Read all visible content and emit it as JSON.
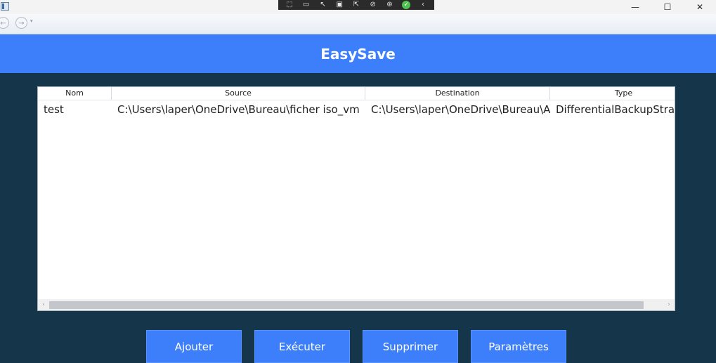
{
  "window": {
    "controls": {
      "minimize": "—",
      "maximize": "☐",
      "close": "✕"
    }
  },
  "debug_toolbar": {
    "icons": [
      "select-element-icon",
      "live-visual-tree-icon",
      "pointer-icon",
      "layout-adorner-icon",
      "track-focus-icon",
      "hot-reload-icon",
      "accessibility-icon",
      "binding-check-icon",
      "collapse-chevron-icon"
    ]
  },
  "navigation": {
    "back": "←",
    "forward": "→",
    "dropdown": "▾"
  },
  "header": {
    "title": "EasySave",
    "color": "#3d7ffa"
  },
  "grid": {
    "columns": [
      "Nom",
      "Source",
      "Destination",
      "Type"
    ],
    "rows": [
      {
        "nom": "test",
        "source": "C:\\Users\\laper\\OneDrive\\Bureau\\ficher iso_vm",
        "destination": "C:\\Users\\laper\\OneDrive\\Bureau\\A",
        "type": "DifferentialBackupStrategy"
      }
    ],
    "scroll": {
      "left": "‹",
      "right": "›"
    }
  },
  "buttons": {
    "ajouter": "Ajouter",
    "executer": "Exécuter",
    "supprimer": "Supprimer",
    "parametres": "Paramètres"
  },
  "colors": {
    "background": "#14354a",
    "accent": "#3d7ffa"
  }
}
